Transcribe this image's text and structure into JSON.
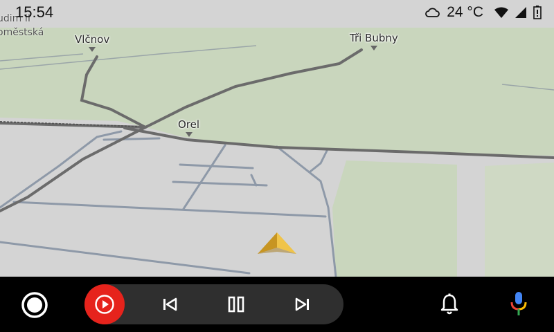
{
  "status": {
    "time": "15:54",
    "temperature": "24 °C",
    "icons": [
      "cloud-icon",
      "wifi-icon",
      "cell-signal-icon",
      "battery-icon"
    ]
  },
  "map": {
    "places": {
      "vlcnov": "Vlčnov",
      "tri_bubny": "Tři Bubny",
      "orel": "Orel"
    },
    "edge_labels": {
      "top": "udim II",
      "second": "oměstská"
    },
    "colors": {
      "land": "#d4d4d4",
      "green": "#c9d6bd",
      "main_road": "#6b6b6b",
      "minor_road": "#8e99a8",
      "position_arrow": "#e0b23a"
    }
  },
  "dock": {
    "home_icon": "home-circle-icon",
    "media_app_icon": "play-circle-icon",
    "controls": [
      "skip-previous-icon",
      "pause-icon",
      "skip-next-icon"
    ],
    "notifications_icon": "bell-icon",
    "assistant_icon": "microphone-icon",
    "colors": {
      "media_app": "#e6231c",
      "pill": "#2f2f2f"
    }
  }
}
